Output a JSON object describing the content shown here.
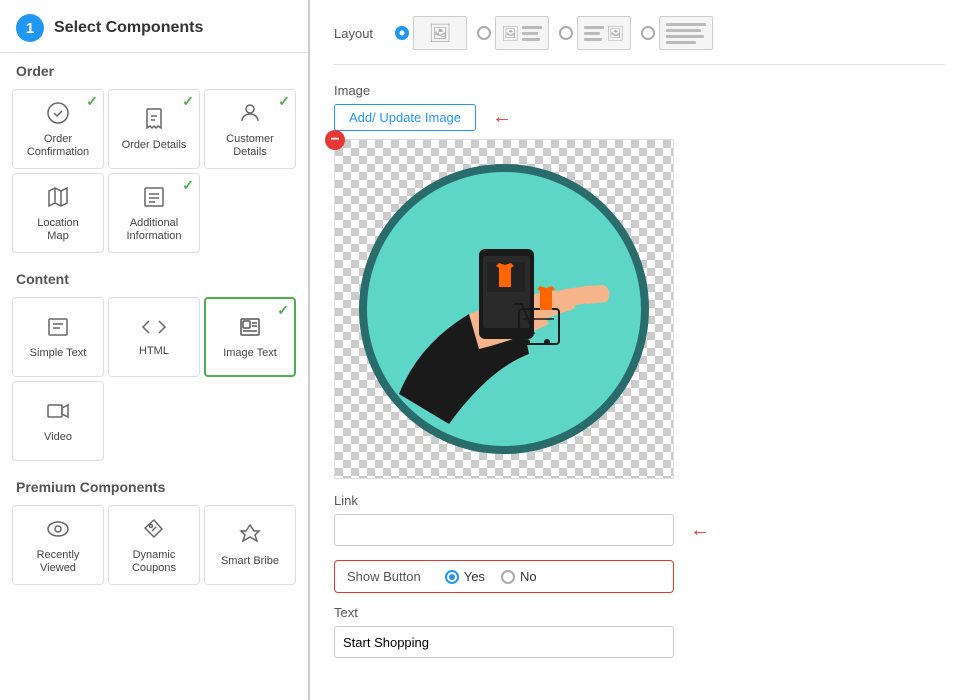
{
  "header": {
    "step_number": "1",
    "title": "Select Components"
  },
  "left_panel": {
    "order_section_label": "Order",
    "order_items": [
      {
        "id": "order-confirmation",
        "label": "Order\nConfirmation",
        "icon": "☑",
        "checked": true,
        "active": false
      },
      {
        "id": "order-details",
        "label": "Order Details",
        "icon": "🛒",
        "checked": true,
        "active": false
      },
      {
        "id": "customer-details",
        "label": "Customer\nDetails",
        "icon": "👤",
        "checked": true,
        "active": false
      },
      {
        "id": "location-map",
        "label": "Location\nMap",
        "icon": "🗺",
        "checked": false,
        "active": false
      },
      {
        "id": "additional-information",
        "label": "Additional\nInformation",
        "icon": "📄",
        "checked": true,
        "active": false
      }
    ],
    "content_section_label": "Content",
    "content_items": [
      {
        "id": "simple-text",
        "label": "Simple Text",
        "icon": "▭",
        "checked": false,
        "active": false
      },
      {
        "id": "html",
        "label": "HTML",
        "icon": "</>",
        "checked": false,
        "active": false
      },
      {
        "id": "image-text",
        "label": "Image Text",
        "icon": "🖼",
        "checked": true,
        "active": true
      },
      {
        "id": "video",
        "label": "Video",
        "icon": "▶",
        "checked": false,
        "active": false
      }
    ],
    "premium_section_label": "Premium Components",
    "premium_items": [
      {
        "id": "recently-viewed",
        "label": "Recently\nViewed",
        "icon": "👁",
        "checked": false,
        "active": false
      },
      {
        "id": "dynamic-coupons",
        "label": "Dynamic\nCoupons",
        "icon": "🏷",
        "checked": false,
        "active": false
      },
      {
        "id": "smart-bribe",
        "label": "Smart Bribe",
        "icon": "🚀",
        "checked": false,
        "active": false
      }
    ]
  },
  "right_panel": {
    "layout_label": "Layout",
    "layout_options": [
      {
        "id": "layout-1",
        "selected": true
      },
      {
        "id": "layout-2",
        "selected": false
      },
      {
        "id": "layout-3",
        "selected": false
      },
      {
        "id": "layout-4",
        "selected": false
      }
    ],
    "image_label": "Image",
    "add_update_btn": "Add/ Update Image",
    "link_label": "Link",
    "link_placeholder": "",
    "show_button_label": "Show Button",
    "yes_label": "Yes",
    "no_label": "No",
    "text_label": "Text",
    "text_value": "Start Shopping"
  }
}
